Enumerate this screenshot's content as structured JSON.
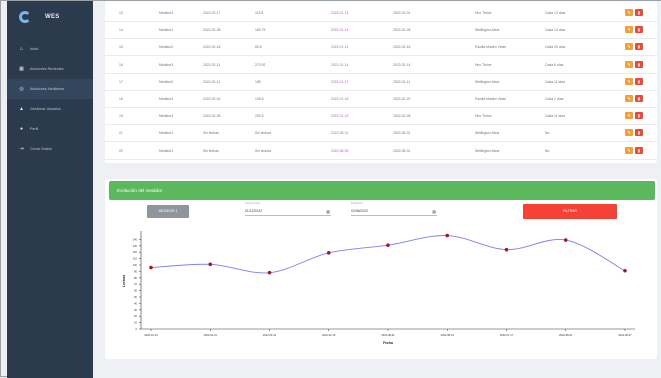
{
  "sidebar": {
    "brand": "WES",
    "items": [
      {
        "label": "Inicio",
        "icon": "home-icon"
      },
      {
        "label": "Advisories Recientes",
        "icon": "grid-icon"
      },
      {
        "label": "Advisories Medidores",
        "icon": "list-icon"
      },
      {
        "label": "Gestionar Usuarios",
        "icon": "users-icon"
      },
      {
        "label": "Perfil",
        "icon": "user-icon"
      },
      {
        "label": "Cerrar Sesión",
        "icon": "logout-icon"
      }
    ]
  },
  "table": {
    "rows": [
      [
        "13",
        "Medidor3",
        "2022-02-17",
        "113.8",
        "2022-01-13",
        "2022-02-01",
        "Hiro Thrive",
        "Cada 13 días"
      ],
      [
        "14",
        "Medidor1",
        "2022-02-28",
        "160.75",
        "2022-01-14",
        "2022-02-28",
        "Wellington Abue",
        "Cada 13 días"
      ],
      [
        "15",
        "Medidor2",
        "2022-02-16",
        "65.5",
        "2022-01-12",
        "2022-02-16",
        "Paolita Maden Vimm",
        "Cada 20 días"
      ],
      [
        "16",
        "Medidor3",
        "2022-02-11",
        "270.92",
        "2022-01-14",
        "2022-02-14",
        "Hiro Thrive",
        "Cada 6 días"
      ],
      [
        "17",
        "Medidor2",
        "2022-02-11",
        "155",
        "2022-01-17",
        "2022-02-11",
        "Wellington Abue",
        "Cada 11 días"
      ],
      [
        "18",
        "Medidor3",
        "2022-02-20",
        "135.8",
        "2022-01-18",
        "2022-02-20",
        "Paolita Maden Vimm",
        "Cada 2 días"
      ],
      [
        "19",
        "Medidor4",
        "2022-02-28",
        "292.5",
        "2022-01-19",
        "2022-02-28",
        "Hiro Thrive",
        "Cada 11 días"
      ],
      [
        "21",
        "Medidor1",
        "Sin fechas",
        "Sin lectura",
        "2022-08-31",
        "2022-08-31",
        "Wellington Abue",
        "No"
      ],
      [
        "22",
        "Medidor1",
        "Sin fechas",
        "Sin lectura",
        "2022-08-03",
        "2022-08-31",
        "Wellington Abue",
        "No"
      ]
    ]
  },
  "chart_section": {
    "title": "Evolución del medidor",
    "select_label": "MEDIDOR 1",
    "date_from": {
      "label": "Fecha inicio",
      "value": "01/12/2022"
    },
    "date_to": {
      "label": "Fecha fin",
      "value": "02/08/2022"
    },
    "filter_label": "FILTRAR"
  },
  "chart_data": {
    "type": "line",
    "xlabel": "Fecha",
    "ylabel": "Lectura",
    "x": [
      "2022-01-13",
      "2022-02-01",
      "2022-02-14",
      "2022-02-16",
      "2022-08-01",
      "2022-08-31",
      "2022-07-17",
      "2022-08-01",
      "2022-08-27"
    ],
    "yticks": [
      0,
      10,
      20,
      30,
      40,
      50,
      60,
      70,
      80,
      90,
      100,
      110,
      120,
      130,
      140
    ],
    "values": [
      96,
      101,
      88,
      119,
      131,
      146,
      124,
      139,
      91
    ],
    "ylim": [
      0,
      150
    ],
    "line_color": "#7b7ff5",
    "point_color": "#a0192a",
    "grid": false
  }
}
